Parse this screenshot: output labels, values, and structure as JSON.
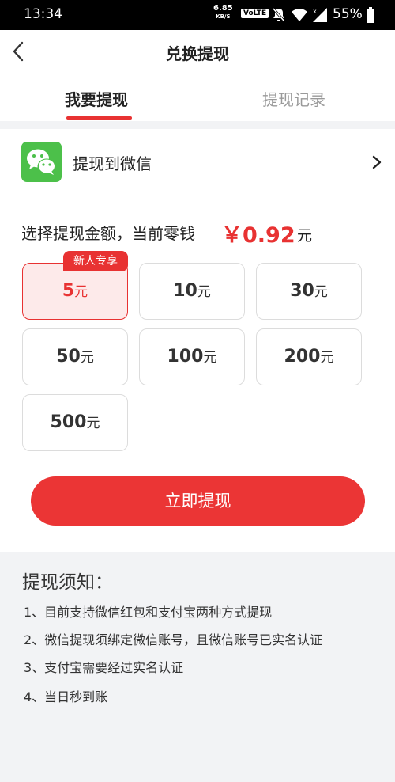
{
  "status_bar": {
    "time": "13:34",
    "net_speed": "6.85",
    "net_unit": "KB/S",
    "volte": "VoLTE",
    "battery": "55%",
    "icons": [
      "mute-icon",
      "wifi-icon",
      "signal-icon",
      "battery-icon"
    ]
  },
  "header": {
    "title": "兑换提现",
    "back_icon": "chevron-left-icon",
    "tabs": [
      {
        "label": "我要提现",
        "active": true
      },
      {
        "label": "提现记录",
        "active": false
      }
    ]
  },
  "withdraw_target": {
    "label": "提现到微信",
    "icon": "wechat-icon"
  },
  "amount": {
    "prompt": "选择提现金额，当前零钱",
    "balance": "￥0.92",
    "unit": "元"
  },
  "options": [
    {
      "value": "5",
      "unit": "元",
      "selected": true,
      "badge": "新人专享"
    },
    {
      "value": "10",
      "unit": "元",
      "selected": false
    },
    {
      "value": "30",
      "unit": "元",
      "selected": false
    },
    {
      "value": "50",
      "unit": "元",
      "selected": false
    },
    {
      "value": "100",
      "unit": "元",
      "selected": false
    },
    {
      "value": "200",
      "unit": "元",
      "selected": false
    },
    {
      "value": "500",
      "unit": "元",
      "selected": false
    }
  ],
  "submit_label": "立即提现",
  "notes": {
    "title": "提现须知：",
    "items": [
      "1、目前支持微信红包和支付宝两种方式提现",
      "2、微信提现须绑定微信账号，且微信账号已实名认证",
      "3、支付宝需要经过实名认证",
      "4、当日秒到账"
    ]
  },
  "colors": {
    "accent": "#e83232",
    "wechat_green": "#4cc04a",
    "background": "#f2f3f5"
  }
}
